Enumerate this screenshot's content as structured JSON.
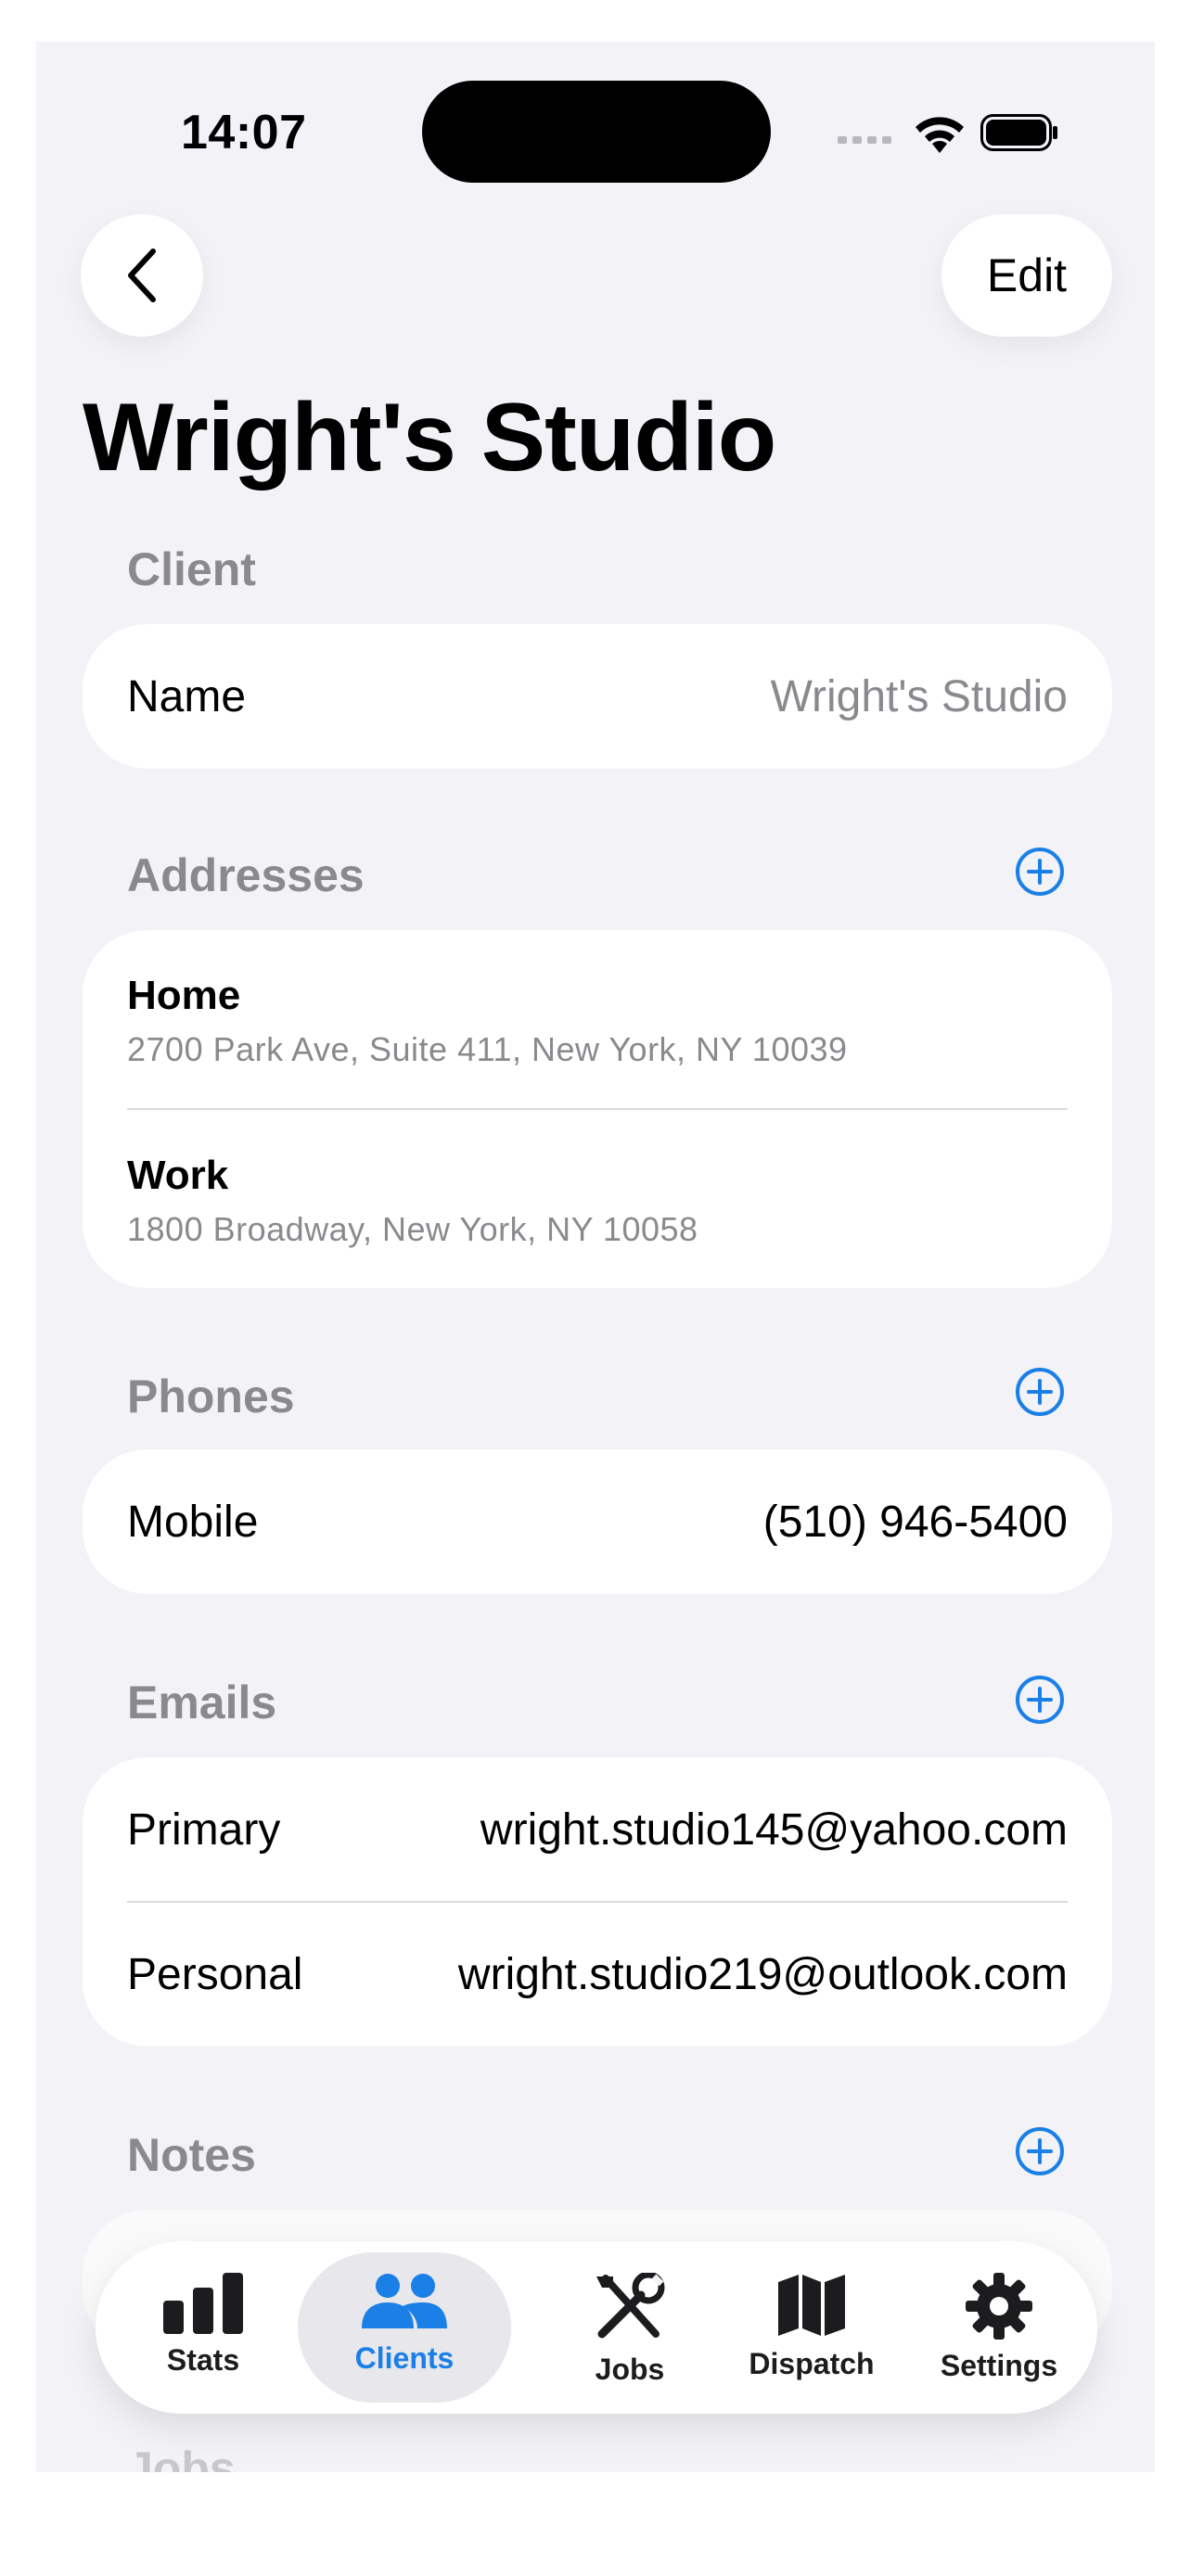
{
  "status_bar": {
    "time": "14:07"
  },
  "nav": {
    "edit_label": "Edit"
  },
  "page": {
    "title": "Wright's Studio"
  },
  "client_section": {
    "header": "Client",
    "name_label": "Name",
    "name_value": "Wright's Studio"
  },
  "addresses_section": {
    "header": "Addresses",
    "items": [
      {
        "label": "Home",
        "address": "2700 Park Ave, Suite 411, New York, NY 10039"
      },
      {
        "label": "Work",
        "address": "1800 Broadway, New York, NY 10058"
      }
    ]
  },
  "phones_section": {
    "header": "Phones",
    "items": [
      {
        "label": "Mobile",
        "value": "(510) 946-5400"
      }
    ]
  },
  "emails_section": {
    "header": "Emails",
    "items": [
      {
        "label": "Primary",
        "value": "wright.studio145@yahoo.com"
      },
      {
        "label": "Personal",
        "value": "wright.studio219@outlook.com"
      }
    ]
  },
  "notes_section": {
    "header": "Notes"
  },
  "jobs_section": {
    "header": "Jobs"
  },
  "tab_bar": {
    "tabs": [
      {
        "label": "Stats",
        "icon": "bar-chart-icon"
      },
      {
        "label": "Clients",
        "icon": "people-icon",
        "selected": true
      },
      {
        "label": "Jobs",
        "icon": "tools-icon"
      },
      {
        "label": "Dispatch",
        "icon": "map-icon"
      },
      {
        "label": "Settings",
        "icon": "gear-icon"
      }
    ]
  },
  "colors": {
    "accent": "#1a7fe6",
    "background": "#f2f2f7",
    "card": "#ffffff",
    "secondary_text": "#8a8a8e"
  }
}
